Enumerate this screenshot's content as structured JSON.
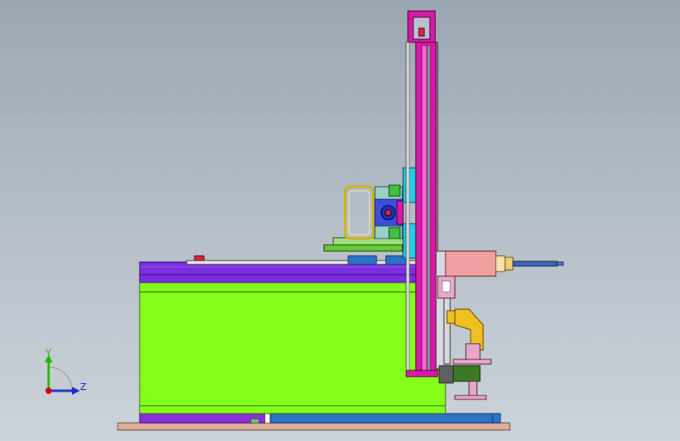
{
  "viewport": {
    "background_top": "#9aa7b3",
    "background_bottom": "#ccd3da"
  },
  "triad": {
    "y_label": "Y",
    "z_label": "Z",
    "y_color": "#1fb800",
    "z_color": "#1630c8",
    "origin_color": "#d00000"
  },
  "colors": {
    "base_plate": "#e0b09c",
    "cabinet_body": "#84ff1a",
    "cabinet_top": "#7b2de0",
    "column": "#d61aa6",
    "bracket_green": "#66cc33",
    "cyan_block": "#20d0e8",
    "motor": "#f0a0a0",
    "spindle_blue": "#3a68b8",
    "fixture_yellow": "#f0c020",
    "fixture_pink": "#e8a8c8",
    "rail_blue": "#2a74c8"
  }
}
